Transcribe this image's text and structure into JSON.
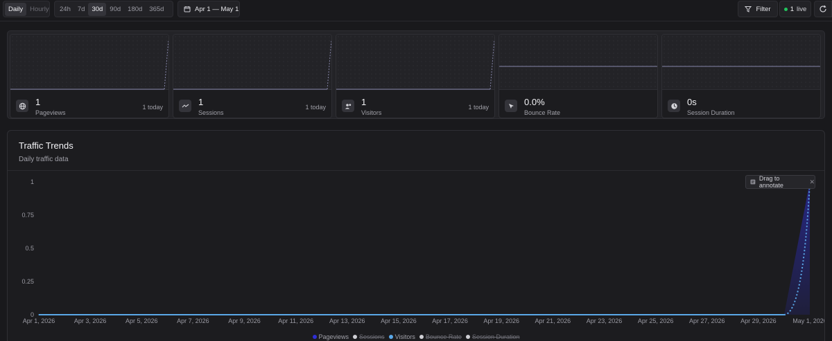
{
  "toolbar": {
    "granularity": [
      "Daily",
      "Hourly"
    ],
    "ranges": [
      "24h",
      "7d",
      "30d",
      "90d",
      "180d",
      "365d"
    ],
    "active_range": "30d",
    "date_range": "Apr 1 — May 1",
    "filter_label": "Filter",
    "live_count": "1",
    "live_label": "live"
  },
  "stats": [
    {
      "value": "1",
      "label": "Pageviews",
      "today": "1 today",
      "icon": "globe-icon"
    },
    {
      "value": "1",
      "label": "Sessions",
      "today": "1 today",
      "icon": "trend-line-icon"
    },
    {
      "value": "1",
      "label": "Visitors",
      "today": "1 today",
      "icon": "users-icon"
    },
    {
      "value": "0.0%",
      "label": "Bounce Rate",
      "today": "",
      "icon": "cursor-icon"
    },
    {
      "value": "0s",
      "label": "Session Duration",
      "today": "",
      "icon": "clock-icon"
    }
  ],
  "trends": {
    "title": "Traffic Trends",
    "subtitle": "Daily traffic data",
    "annotate_label": "Drag to annotate"
  },
  "colors": {
    "pageviews": "#2f2fd6",
    "visitors": "#5aa8e8",
    "disabled": "#d0d0d5",
    "accent": "#22c55e"
  },
  "legend": [
    {
      "name": "Pageviews",
      "color": "#2f2fd6",
      "enabled": true
    },
    {
      "name": "Sessions",
      "color": "#d0d0d5",
      "enabled": false
    },
    {
      "name": "Visitors",
      "color": "#5aa8e8",
      "enabled": true
    },
    {
      "name": "Bounce Rate",
      "color": "#d0d0d5",
      "enabled": false
    },
    {
      "name": "Session Duration",
      "color": "#d0d0d5",
      "enabled": false
    }
  ],
  "chart_data": {
    "type": "area",
    "x": [
      "Apr 1, 2026",
      "Apr 2, 2026",
      "Apr 3, 2026",
      "Apr 4, 2026",
      "Apr 5, 2026",
      "Apr 6, 2026",
      "Apr 7, 2026",
      "Apr 8, 2026",
      "Apr 9, 2026",
      "Apr 10, 2026",
      "Apr 11, 2026",
      "Apr 12, 2026",
      "Apr 13, 2026",
      "Apr 14, 2026",
      "Apr 15, 2026",
      "Apr 16, 2026",
      "Apr 17, 2026",
      "Apr 18, 2026",
      "Apr 19, 2026",
      "Apr 20, 2026",
      "Apr 21, 2026",
      "Apr 22, 2026",
      "Apr 23, 2026",
      "Apr 24, 2026",
      "Apr 25, 2026",
      "Apr 26, 2026",
      "Apr 27, 2026",
      "Apr 28, 2026",
      "Apr 29, 2026",
      "Apr 30, 2026",
      "May 1, 2026"
    ],
    "x_tick_labels": [
      "Apr 1, 2026",
      "Apr 3, 2026",
      "Apr 5, 2026",
      "Apr 7, 2026",
      "Apr 9, 2026",
      "Apr 11, 2026",
      "Apr 13, 2026",
      "Apr 15, 2026",
      "Apr 17, 2026",
      "Apr 19, 2026",
      "Apr 21, 2026",
      "Apr 23, 2026",
      "Apr 25, 2026",
      "Apr 27, 2026",
      "Apr 29, 2026",
      "May 1, 2026"
    ],
    "y_tick_labels": [
      "0",
      "0.25",
      "0.5",
      "0.75",
      "1"
    ],
    "ylim": [
      0,
      1
    ],
    "series": [
      {
        "name": "Pageviews",
        "values": [
          0,
          0,
          0,
          0,
          0,
          0,
          0,
          0,
          0,
          0,
          0,
          0,
          0,
          0,
          0,
          0,
          0,
          0,
          0,
          0,
          0,
          0,
          0,
          0,
          0,
          0,
          0,
          0,
          0,
          0,
          1
        ]
      },
      {
        "name": "Visitors",
        "values": [
          0,
          0,
          0,
          0,
          0,
          0,
          0,
          0,
          0,
          0,
          0,
          0,
          0,
          0,
          0,
          0,
          0,
          0,
          0,
          0,
          0,
          0,
          0,
          0,
          0,
          0,
          0,
          0,
          0,
          0,
          1
        ]
      }
    ],
    "grid": false
  }
}
